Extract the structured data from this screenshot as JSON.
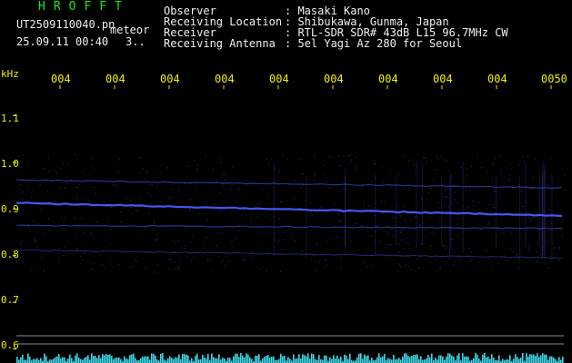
{
  "header": {
    "title": "HROFFT",
    "filename": "UT2509110040.pn",
    "mode": "meteor",
    "date": "25.09.11 00:40",
    "index": "3.."
  },
  "info": [
    {
      "label": "Observer",
      "value": ": Masaki Kano"
    },
    {
      "label": "Receiving Location",
      "value": ": Shibukawa, Gunma, Japan"
    },
    {
      "label": "Receiver",
      "value": ": RTL-SDR SDR# 43dB L15 96.7MHz CW"
    },
    {
      "label": "Receiving Antenna",
      "value": ": 5el Yagi Az 280 for Seoul"
    }
  ],
  "axes": {
    "y_unit": "kHz",
    "y_ticks": [
      "1.1",
      "1.0",
      "0.9",
      "0.8",
      "0.7",
      "0.6"
    ],
    "x_ticks": [
      "004",
      "004",
      "004",
      "004",
      "004",
      "004",
      "004",
      "004",
      "004",
      "0050"
    ]
  },
  "colors": {
    "background": "#000000",
    "header_green": "#19e619",
    "axis_yellow": "#f0f000",
    "trace_blue": "#4a5cff",
    "level_cyan": "#3fd6e6"
  },
  "chart_data": {
    "type": "heatmap",
    "ylabel": "kHz",
    "ylim": [
      0.57,
      1.19
    ],
    "x_tick_labels": [
      "004",
      "004",
      "004",
      "004",
      "004",
      "004",
      "004",
      "004",
      "004",
      "0050"
    ],
    "y_tick_labels": [
      "1.1",
      "1.0",
      "0.9",
      "0.8",
      "0.7",
      "0.6"
    ],
    "traces": [
      {
        "y_start": 0.913,
        "y_end": 0.885,
        "intensity": "strong"
      },
      {
        "y_start": 0.962,
        "y_end": 0.945,
        "intensity": "weak"
      },
      {
        "y_start": 0.865,
        "y_end": 0.858,
        "intensity": "weak"
      },
      {
        "y_start": 0.812,
        "y_end": 0.795,
        "intensity": "faint"
      }
    ]
  }
}
